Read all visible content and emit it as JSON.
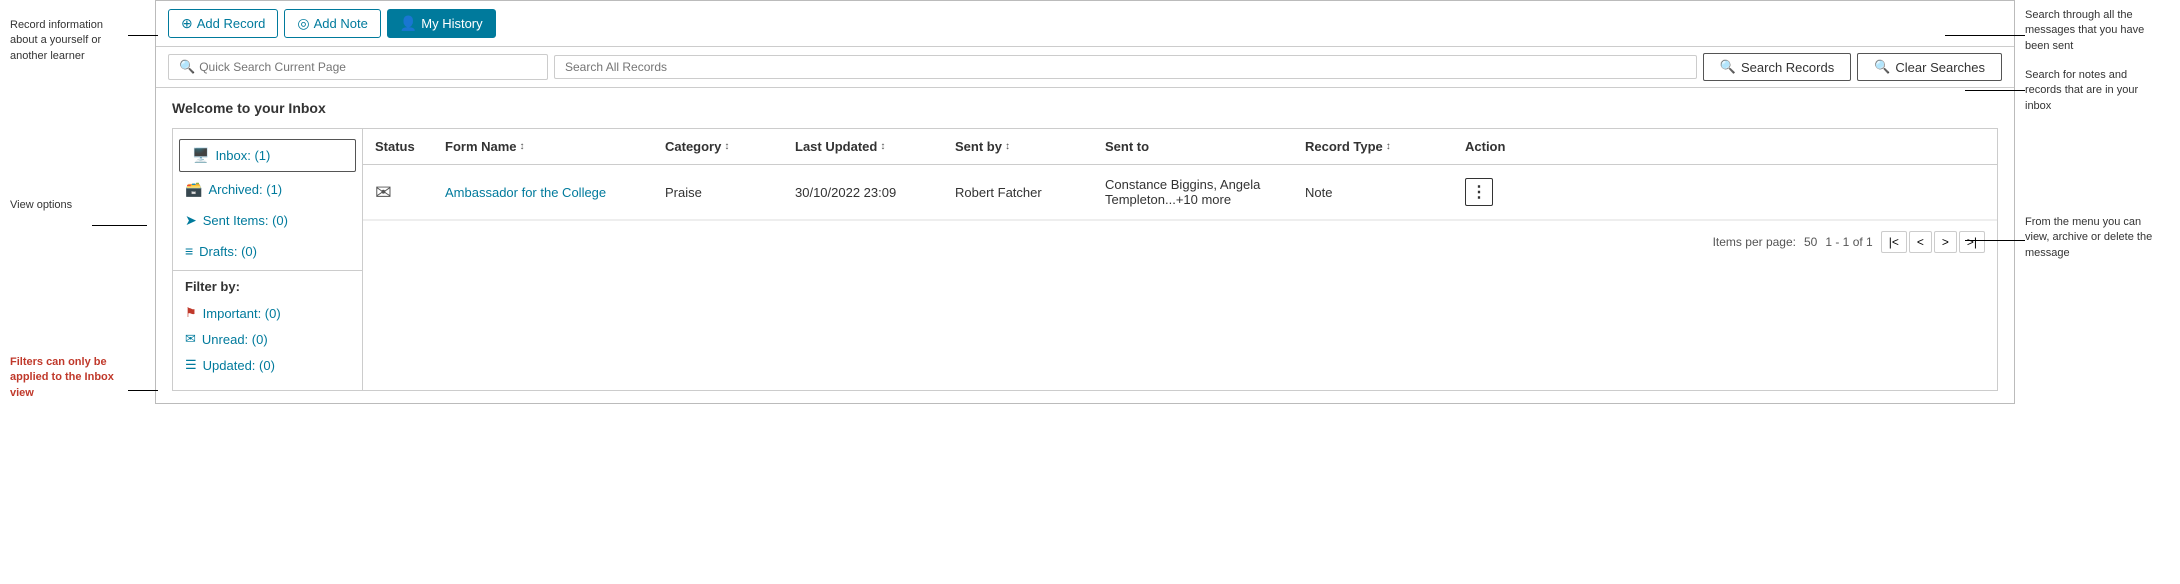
{
  "toolbar": {
    "add_record_label": "Add Record",
    "add_note_label": "Add Note",
    "my_history_label": "My History"
  },
  "search": {
    "quick_placeholder": "Quick Search Current Page",
    "all_placeholder": "Search All Records",
    "search_btn_label": "Search Records",
    "clear_btn_label": "Clear Searches"
  },
  "main": {
    "welcome_title": "Welcome to your Inbox"
  },
  "sidebar": {
    "nav_items": [
      {
        "label": "Inbox: (1)",
        "icon": "inbox"
      },
      {
        "label": "Archived: (1)",
        "icon": "archive"
      },
      {
        "label": "Sent Items: (0)",
        "icon": "sent"
      },
      {
        "label": "Drafts: (0)",
        "icon": "draft"
      }
    ],
    "filter_title": "Filter by:",
    "filter_items": [
      {
        "label": "Important: (0)",
        "icon": "flag"
      },
      {
        "label": "Unread: (0)",
        "icon": "unread"
      },
      {
        "label": "Updated: (0)",
        "icon": "updated"
      }
    ]
  },
  "table": {
    "columns": [
      {
        "label": "Status"
      },
      {
        "label": "Form Name"
      },
      {
        "label": "Category"
      },
      {
        "label": "Last Updated"
      },
      {
        "label": "Sent by"
      },
      {
        "label": "Sent to"
      },
      {
        "label": "Record Type"
      },
      {
        "label": "Action"
      }
    ],
    "rows": [
      {
        "status_icon": "envelope",
        "form_name": "Ambassador for the College",
        "form_link": "#",
        "category": "Praise",
        "last_updated": "30/10/2022 23:09",
        "sent_by": "Robert Fatcher",
        "sent_to": "Constance Biggins, Angela Templeton...+10 more",
        "record_type": "Note",
        "action": "⋮"
      }
    ]
  },
  "pagination": {
    "items_per_page_label": "Items per page:",
    "items_per_page_value": "50",
    "range": "1 - 1 of 1"
  },
  "annotations": {
    "left_top": "Record information about a yourself or another learner",
    "left_mid": "View options",
    "left_bottom_bold": "Filters can only be applied to the Inbox view",
    "right_top": "Search through all the messages that you have been sent",
    "right_bottom": "Search for notes and records that are in your inbox",
    "right_action": "From the menu you can view, archive or delete the message"
  }
}
